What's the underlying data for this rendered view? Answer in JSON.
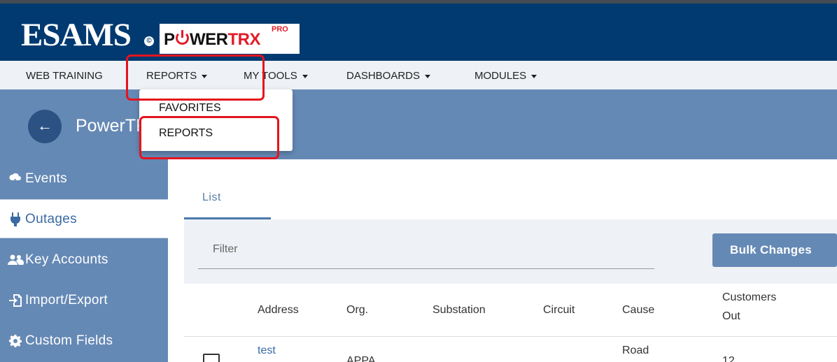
{
  "brand": {
    "name": "ESAMS",
    "copyright_mark": "©",
    "product_prefix": "P",
    "product_main": "WER",
    "product_trx": "TRX",
    "product_tm": "™",
    "product_tier": "PRO"
  },
  "nav": {
    "items": [
      {
        "label": "WEB TRAINING",
        "dropdown": false
      },
      {
        "label": "REPORTS",
        "dropdown": true
      },
      {
        "label": "MY TOOLS",
        "dropdown": true
      },
      {
        "label": "DASHBOARDS",
        "dropdown": true
      },
      {
        "label": "MODULES",
        "dropdown": true
      }
    ]
  },
  "dropdown": {
    "items": [
      "FAVORITES",
      "REPORTS"
    ]
  },
  "header": {
    "back_icon": "arrow-left-icon",
    "title": "PowerTRX Outages"
  },
  "sidebar": {
    "items": [
      {
        "label": "Events",
        "icon": "storm-cloud-icon",
        "active": false
      },
      {
        "label": "Outages",
        "icon": "plug-icon",
        "active": true
      },
      {
        "label": "Key Accounts",
        "icon": "users-icon",
        "active": false
      },
      {
        "label": "Import/Export",
        "icon": "file-import-icon",
        "active": false
      },
      {
        "label": "Custom Fields",
        "icon": "gear-icon",
        "active": false
      }
    ]
  },
  "tabs": [
    {
      "label": "List",
      "active": true
    }
  ],
  "filter": {
    "label": "Filter"
  },
  "bulk_changes_label": "Bulk Changes",
  "table": {
    "columns": [
      "Address",
      "Org.",
      "Substation",
      "Circuit",
      "Cause",
      "Customers",
      "Out"
    ],
    "rows": [
      {
        "address": "test",
        "org": "APPA",
        "substation": "",
        "circuit": "",
        "cause": "Road",
        "customers_out": "12"
      }
    ]
  },
  "colors": {
    "brand_bar": "#003a70",
    "header": "#6589b5",
    "highlight": "#e4141e",
    "nav_bg": "#eef1f5"
  }
}
